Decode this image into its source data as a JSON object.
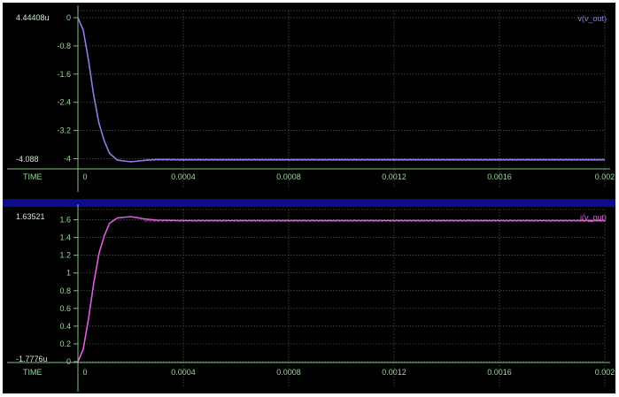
{
  "chart_data": [
    {
      "type": "line",
      "x_axis_label": "TIME",
      "x_ticks": [
        "0",
        "0.0004",
        "0.0008",
        "0.0012",
        "0.0016",
        "0.002"
      ],
      "xlim": [
        0,
        0.002
      ],
      "ylim": [
        -4.088,
        4.44408e-06
      ],
      "y_ticks": [
        "0",
        "-0.8",
        "-1.6",
        "-2.4",
        "-3.2",
        "-4"
      ],
      "y_max_label": "4.44408u",
      "y_min_label": "-4.088",
      "grid": true,
      "series": [
        {
          "name": "v(v_out)",
          "color": "#8a7fe6",
          "x": [
            0,
            2e-05,
            4e-05,
            6e-05,
            8e-05,
            0.0001,
            0.00012,
            0.00015,
            0.0002,
            0.00025,
            0.0003,
            0.0004,
            0.0006,
            0.0008,
            0.001,
            0.0012,
            0.0014,
            0.0016,
            0.0018,
            0.002
          ],
          "y": [
            0,
            -0.35,
            -1.2,
            -2.2,
            -3.0,
            -3.5,
            -3.85,
            -4.04,
            -4.088,
            -4.05,
            -4.02,
            -4.03,
            -4.03,
            -4.03,
            -4.03,
            -4.03,
            -4.03,
            -4.03,
            -4.03,
            -4.03
          ]
        }
      ]
    },
    {
      "type": "line",
      "x_axis_label": "TIME",
      "x_ticks": [
        "0",
        "0.0004",
        "0.0008",
        "0.0012",
        "0.0016",
        "0.002"
      ],
      "xlim": [
        0,
        0.002
      ],
      "ylim": [
        -1.7776e-06,
        1.63521
      ],
      "y_ticks": [
        "1.6",
        "1.4",
        "1.2",
        "1",
        "0.8",
        "0.6",
        "0.4",
        "0.2",
        "0"
      ],
      "y_max_label": "1.63521",
      "y_min_label": "-1.7776u",
      "grid": true,
      "series": [
        {
          "name": "i(v_out)",
          "color": "#e35ce0",
          "x": [
            0,
            2e-05,
            4e-05,
            6e-05,
            8e-05,
            0.0001,
            0.00012,
            0.00015,
            0.0002,
            0.00025,
            0.0003,
            0.0004,
            0.0006,
            0.0008,
            0.001,
            0.0012,
            0.0014,
            0.0016,
            0.0018,
            0.002
          ],
          "y": [
            0,
            0.14,
            0.48,
            0.88,
            1.22,
            1.42,
            1.56,
            1.62,
            1.635,
            1.61,
            1.595,
            1.59,
            1.59,
            1.59,
            1.59,
            1.59,
            1.59,
            1.59,
            1.59,
            1.59
          ]
        }
      ]
    }
  ]
}
